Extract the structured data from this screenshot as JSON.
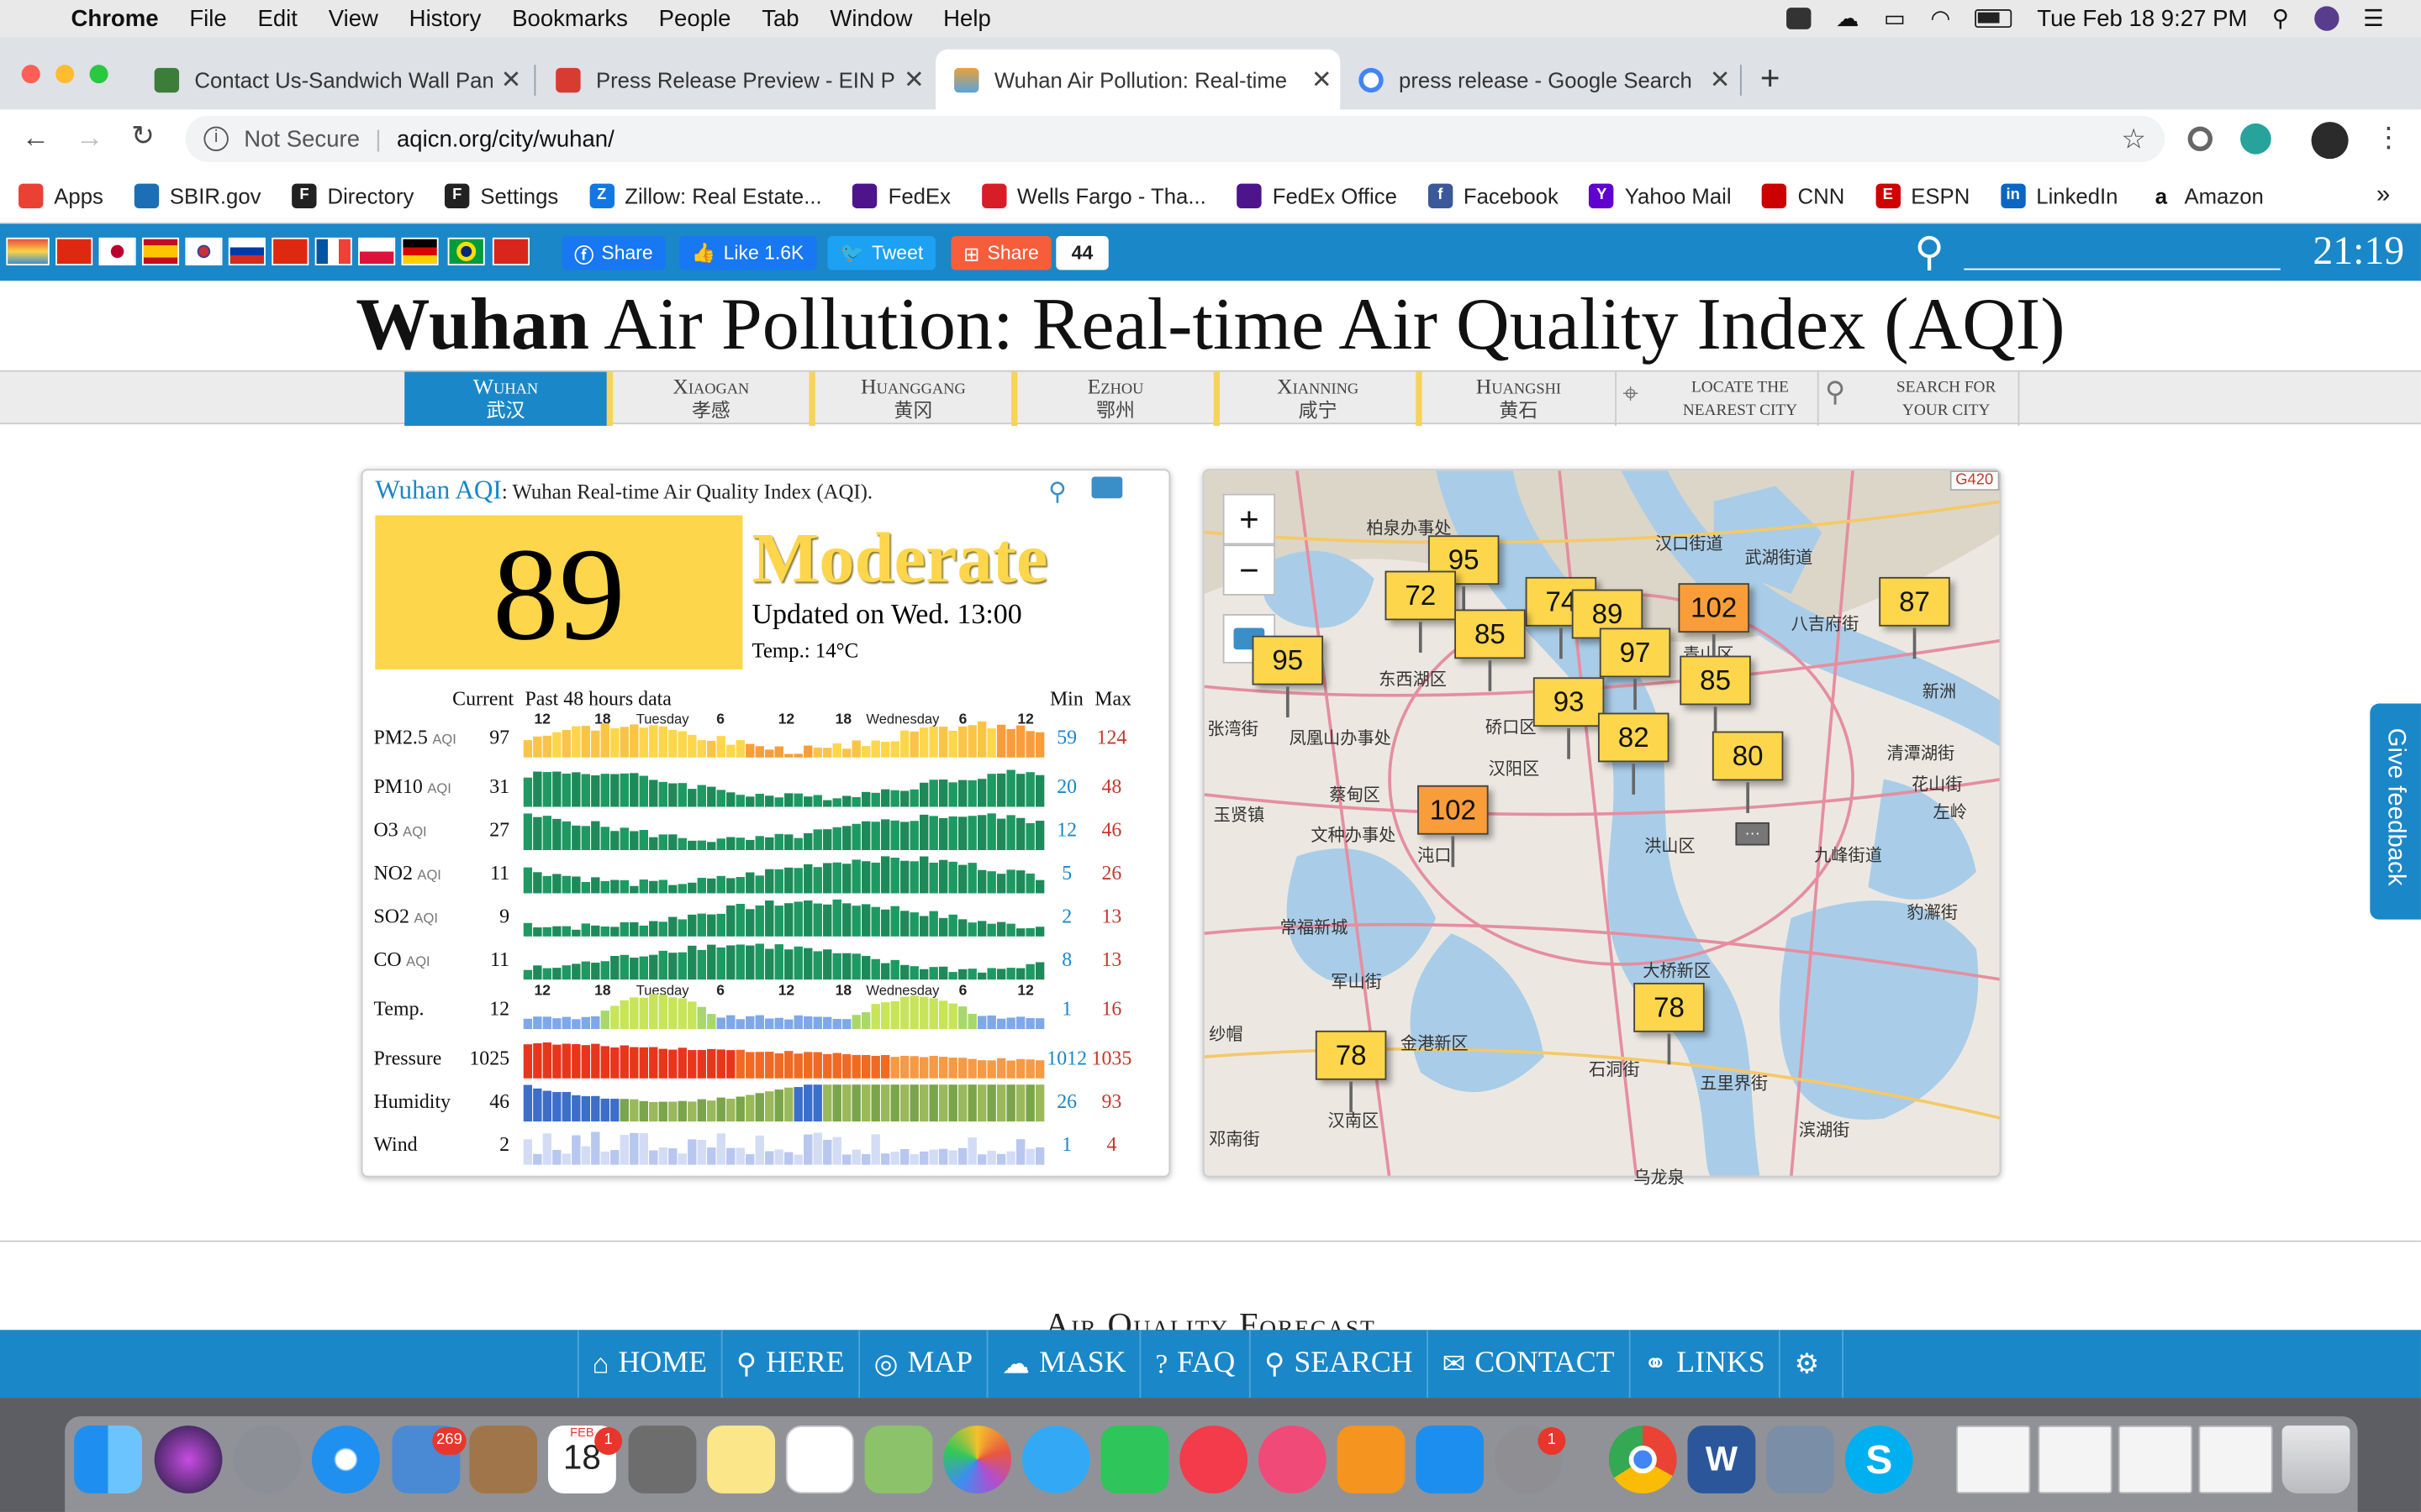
{
  "menubar": {
    "app": "Chrome",
    "items": [
      "File",
      "Edit",
      "View",
      "History",
      "Bookmarks",
      "People",
      "Tab",
      "Window",
      "Help"
    ],
    "clock": "Tue Feb 18  9:27 PM"
  },
  "tabs": [
    {
      "title": "Contact Us-Sandwich Wall Pan",
      "color": "#3c7d3a"
    },
    {
      "title": "Press Release Preview - EIN Pr",
      "color": "#d83b2f"
    },
    {
      "title": "Wuhan Air Pollution: Real-time",
      "color": "#e9a23b"
    },
    {
      "title": "press release - Google Search",
      "color": "#4285f4"
    }
  ],
  "omnibox": {
    "security": "Not Secure",
    "url": "aqicn.org/city/wuhan/"
  },
  "bookmarks": [
    {
      "label": "Apps",
      "color": "#e94235"
    },
    {
      "label": "SBIR.gov",
      "color": "#1c6fb4"
    },
    {
      "label": "Directory",
      "color": "#222222"
    },
    {
      "label": "Settings",
      "color": "#222222"
    },
    {
      "label": "Zillow: Real Estate...",
      "color": "#1277e1"
    },
    {
      "label": "FedEx",
      "color": "#4d148c"
    },
    {
      "label": "Wells Fargo - Tha...",
      "color": "#d71e28"
    },
    {
      "label": "FedEx Office",
      "color": "#4d148c"
    },
    {
      "label": "Facebook",
      "color": "#3b5998"
    },
    {
      "label": "Yahoo Mail",
      "color": "#6001d2"
    },
    {
      "label": "CNN",
      "color": "#cc0000"
    },
    {
      "label": "ESPN",
      "color": "#d00000"
    },
    {
      "label": "LinkedIn",
      "color": "#0a66c2"
    },
    {
      "label": "Amazon",
      "color": "#222222"
    }
  ],
  "social": {
    "fb_share": "Share",
    "like": "Like 1.6K",
    "tweet": "Tweet",
    "share": "Share",
    "share_count": "44",
    "clock": "21:19"
  },
  "page": {
    "title_bold": "Wuhan",
    "title_rest": " Air Pollution: Real-time Air Quality Index (AQI)"
  },
  "cities": [
    {
      "en": "Wuhan",
      "cn": "武汉"
    },
    {
      "en": "Xiaogan",
      "cn": "孝感"
    },
    {
      "en": "Huanggang",
      "cn": "黄冈"
    },
    {
      "en": "Ezhou",
      "cn": "鄂州"
    },
    {
      "en": "Xianning",
      "cn": "咸宁"
    },
    {
      "en": "Huangshi",
      "cn": "黄石"
    }
  ],
  "city_tools": {
    "locate_1": "LOCATE THE",
    "locate_2": "NEAREST CITY",
    "search_1": "SEARCH FOR",
    "search_2": "YOUR CITY"
  },
  "aqi": {
    "link": "Wuhan AQI",
    "subtitle": ": Wuhan Real-time Air Quality Index (AQI).",
    "value": "89",
    "status": "Moderate",
    "updated": "Updated on Wed. 13:00",
    "temp": "Temp.: 14°C",
    "colors": {
      "moderate": "#fdd64b",
      "unhealthy_sensitive": "#f99d3a",
      "good": "#1d9a62"
    }
  },
  "table": {
    "h_current": "Current",
    "h_past": "Past 48 hours data",
    "h_min": "Min",
    "h_max": "Max",
    "axis_ticks": [
      "12",
      "18",
      "Tuesday",
      "6",
      "12",
      "18",
      "Wednesday",
      "6",
      "12"
    ],
    "rows": [
      {
        "name": "PM2.5",
        "unit": "AQI",
        "current": "97",
        "min": "59",
        "max": "124"
      },
      {
        "name": "PM10",
        "unit": "AQI",
        "current": "31",
        "min": "20",
        "max": "48"
      },
      {
        "name": "O3",
        "unit": "AQI",
        "current": "27",
        "min": "12",
        "max": "46"
      },
      {
        "name": "NO2",
        "unit": "AQI",
        "current": "11",
        "min": "5",
        "max": "26"
      },
      {
        "name": "SO2",
        "unit": "AQI",
        "current": "9",
        "min": "2",
        "max": "13"
      },
      {
        "name": "CO",
        "unit": "AQI",
        "current": "11",
        "min": "8",
        "max": "13"
      },
      {
        "name": "Temp.",
        "unit": "",
        "current": "12",
        "min": "1",
        "max": "16"
      },
      {
        "name": "Pressure",
        "unit": "",
        "current": "1025",
        "min": "1012",
        "max": "1035"
      },
      {
        "name": "Humidity",
        "unit": "",
        "current": "46",
        "min": "26",
        "max": "93"
      },
      {
        "name": "Wind",
        "unit": "",
        "current": "2",
        "min": "1",
        "max": "4"
      }
    ]
  },
  "map": {
    "zoom_in": "+",
    "zoom_out": "−",
    "road_label": "G420",
    "stations": [
      {
        "value": "95",
        "color": "#fdd64b"
      },
      {
        "value": "72",
        "color": "#fdd64b"
      },
      {
        "value": "74",
        "color": "#fdd64b"
      },
      {
        "value": "89",
        "color": "#fdd64b"
      },
      {
        "value": "102",
        "color": "#f99d3a"
      },
      {
        "value": "87",
        "color": "#fdd64b"
      },
      {
        "value": "85",
        "color": "#fdd64b"
      },
      {
        "value": "95",
        "color": "#fdd64b"
      },
      {
        "value": "97",
        "color": "#fdd64b"
      },
      {
        "value": "85",
        "color": "#fdd64b"
      },
      {
        "value": "93",
        "color": "#fdd64b"
      },
      {
        "value": "82",
        "color": "#fdd64b"
      },
      {
        "value": "80",
        "color": "#fdd64b"
      },
      {
        "value": "102",
        "color": "#f99d3a"
      },
      {
        "value": "78",
        "color": "#fdd64b"
      },
      {
        "value": "78",
        "color": "#fdd64b"
      }
    ],
    "places": [
      "柏泉办事处",
      "汉口街道",
      "武湖街道",
      "八吉府街",
      "东西湖区",
      "张湾街",
      "新洲",
      "硚口区",
      "汉阳区",
      "凤凰山办事处",
      "清潭湖街",
      "花山街",
      "蔡甸区",
      "玉贤镇",
      "洪山区",
      "文种办事处",
      "沌口",
      "九峰街道",
      "左岭",
      "常福新城",
      "豹澥街",
      "军山街",
      "大桥新区",
      "金港新区",
      "石洞街",
      "五里界街",
      "纱帽",
      "汉南区",
      "邓南街",
      "滨湖街",
      "乌龙泉",
      "青山区"
    ]
  },
  "feedback": "Give feedback",
  "forecast": "Air Quality Forecast",
  "bottom_nav": [
    {
      "icon": "⌂",
      "label": "HOME"
    },
    {
      "icon": "⚲",
      "label": "HERE"
    },
    {
      "icon": "◎",
      "label": "MAP"
    },
    {
      "icon": "☁",
      "label": "MASK"
    },
    {
      "icon": "?",
      "label": "FAQ"
    },
    {
      "icon": "⚲",
      "label": "SEARCH"
    },
    {
      "icon": "✉",
      "label": "CONTACT"
    },
    {
      "icon": "⚭",
      "label": "LINKS"
    },
    {
      "icon": "⚙",
      "label": ""
    }
  ],
  "dock": {
    "mail_badge": "269",
    "calendar_month": "FEB",
    "calendar_day": "18",
    "calendar_badge": "1",
    "prefs_badge": "1",
    "word_letter": "W",
    "skype_letter": "S"
  }
}
